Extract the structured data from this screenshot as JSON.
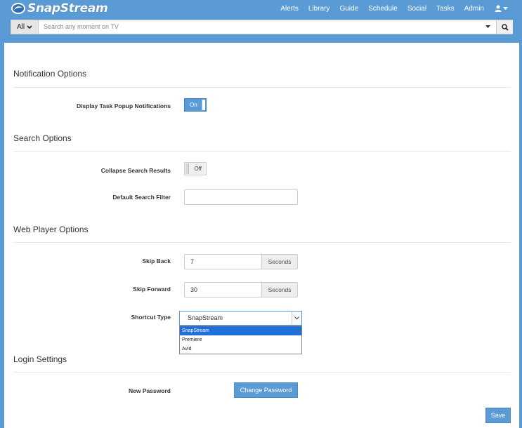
{
  "brand": {
    "name": "SnapStream"
  },
  "nav": {
    "items": [
      "Alerts",
      "Library",
      "Guide",
      "Schedule",
      "Social",
      "Tasks",
      "Admin"
    ]
  },
  "search": {
    "scope": "All",
    "placeholder": "Search any moment on TV"
  },
  "sections": {
    "notification": {
      "title": "Notification Options",
      "popup_label": "Display Task Popup Notifications",
      "popup_toggle": "On"
    },
    "search": {
      "title": "Search Options",
      "collapse_label": "Collapse Search Results",
      "collapse_toggle": "Off",
      "filter_label": "Default Search Filter",
      "filter_value": ""
    },
    "player": {
      "title": "Web Player Options",
      "skip_back_label": "Skip Back",
      "skip_back_value": "7",
      "skip_forward_label": "Skip Forward",
      "skip_forward_value": "30",
      "seconds_unit": "Seconds",
      "shortcut_label": "Shortcut Type",
      "shortcut_value": "SnapStream",
      "shortcut_options": [
        "SnapStream",
        "Premiere",
        "Avid"
      ]
    },
    "login": {
      "title": "Login Settings",
      "password_label": "New Password",
      "change_password_button": "Change Password"
    }
  },
  "footer": {
    "save_button": "Save"
  },
  "colors": {
    "accent": "#5b9bd5",
    "selected_option": "#1e6fd9"
  }
}
